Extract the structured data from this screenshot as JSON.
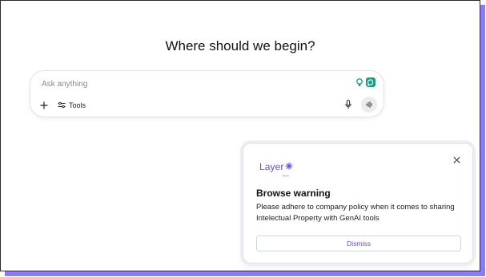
{
  "main": {
    "heading": "Where should we begin?"
  },
  "composer": {
    "placeholder": "Ask anything",
    "tools_label": "Tools",
    "icons": {
      "add": "plus-icon",
      "tools": "sliders-icon",
      "extension_1": "lightbulb-icon",
      "extension_2": "chat-bubble-icon",
      "mic": "microphone-icon",
      "voice": "voice-waveform-icon"
    }
  },
  "popup": {
    "logo_text": "Layer",
    "logo_subtext": "Demo",
    "title": "Browse warning",
    "body": "Please adhere to company policy when it comes to sharing Intelectual Property with GenAI tools",
    "dismiss_label": "Dismiss",
    "close_icon": "close-icon",
    "brand_color": "#6b4ad6"
  },
  "colors": {
    "frame_shadow": "#8b7cf0",
    "extension_teal": "#1f9d83"
  }
}
